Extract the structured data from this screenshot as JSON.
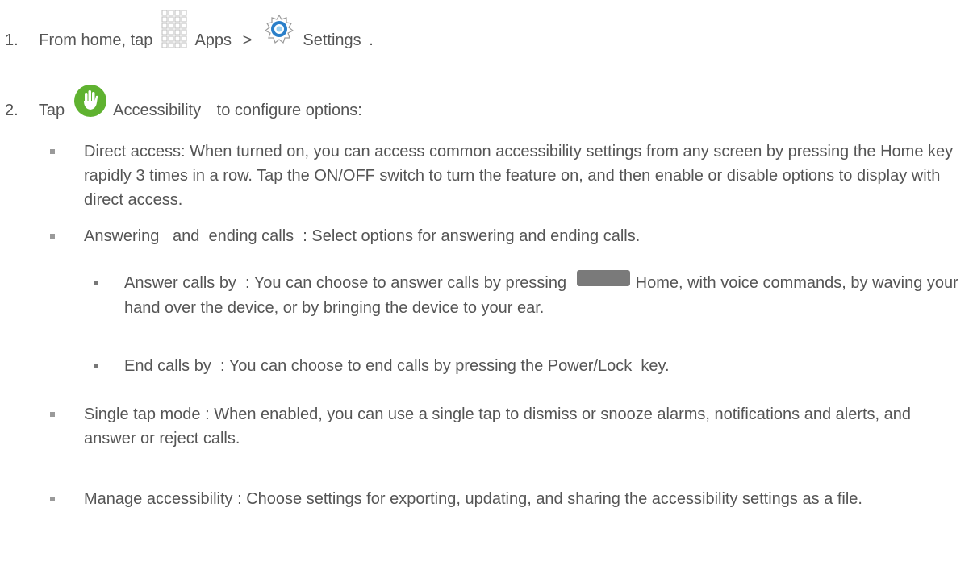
{
  "steps": [
    {
      "number": "1.",
      "prefix": "From home, tap",
      "apps_label": "Apps",
      "separator": ">",
      "settings_label": "Settings",
      "suffix": "."
    },
    {
      "number": "2.",
      "prefix": "Tap",
      "accessibility_label": "Accessibility",
      "suffix": "to configure options:"
    }
  ],
  "options": [
    {
      "text": "Direct access: When turned on, you can access common accessibility settings from any screen by pressing the Home key rapidly 3 times in a row. Tap the ON/OFF switch to turn the feature on, and then enable or disable options to display with direct access."
    },
    {
      "text": "Answering   and  ending calls  : Select options for answering and ending calls."
    },
    {
      "text": "Single tap mode  : When enabled, you can use a single tap to dismiss or snooze alarms, notifications and alerts, and answer or reject calls."
    },
    {
      "text": "Manage accessibility   : Choose settings for exporting, updating, and sharing the accessibility settings as a file."
    }
  ],
  "sub_options": [
    {
      "prefix": "Answer calls by  : You can choose to answer calls by pressing",
      "home_label": "Home",
      "suffix": ", with voice commands, by waving your hand over the device, or by bringing the device to your ear."
    },
    {
      "text": "End calls by  : You can choose to end calls by pressing the Power/Lock  key."
    }
  ],
  "colors": {
    "text": "#555555",
    "accessibility_icon": "#5fb230",
    "settings_icon": "#2a7fc9",
    "home_key": "#7a7a7a"
  }
}
